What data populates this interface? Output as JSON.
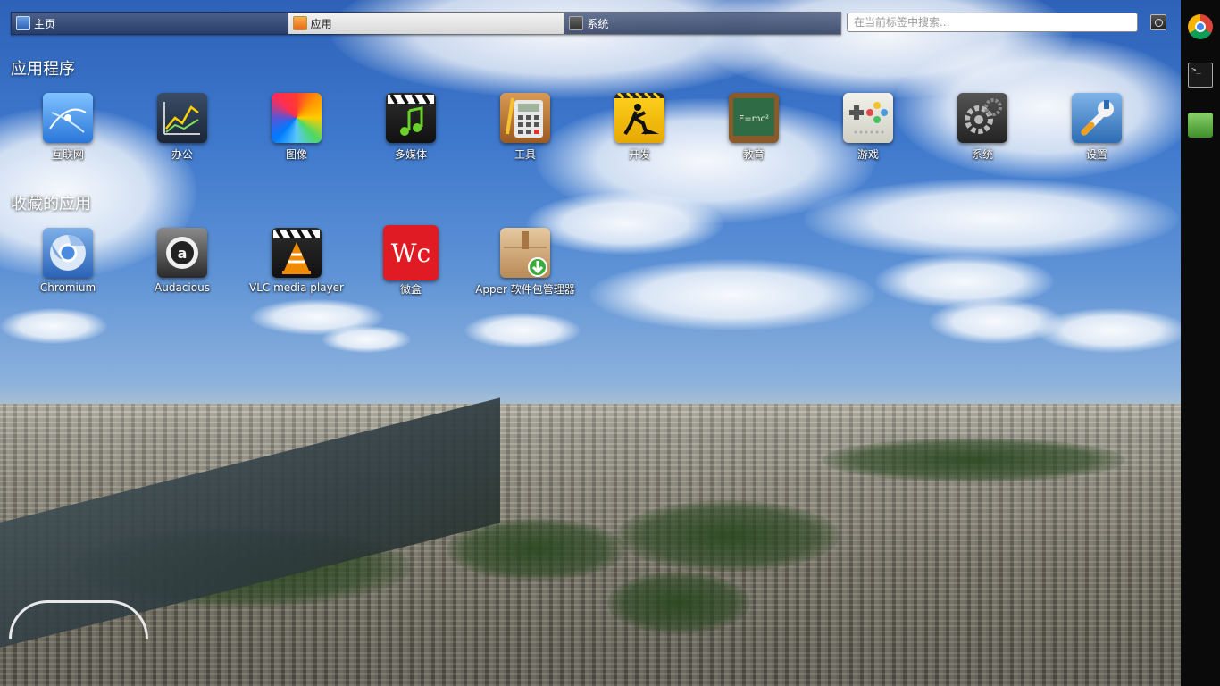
{
  "topbar": {
    "tabs": [
      {
        "label": "主页",
        "icon": "home-icon"
      },
      {
        "label": "应用",
        "icon": "apps-icon",
        "active": true
      },
      {
        "label": "系统",
        "icon": "system-icon"
      }
    ],
    "search_placeholder": "在当前标签中搜索..."
  },
  "sections": {
    "applications_title": "应用程序",
    "favorites_title": "收藏的应用"
  },
  "categories": [
    {
      "label": "互联网",
      "icon": "internet-icon"
    },
    {
      "label": "办公",
      "icon": "office-chart-icon"
    },
    {
      "label": "图像",
      "icon": "graphics-icon"
    },
    {
      "label": "多媒体",
      "icon": "multimedia-icon"
    },
    {
      "label": "工具",
      "icon": "calculator-icon"
    },
    {
      "label": "开发",
      "icon": "development-icon"
    },
    {
      "label": "教育",
      "icon": "education-chalkboard-icon"
    },
    {
      "label": "游戏",
      "icon": "gamepad-icon"
    },
    {
      "label": "系统",
      "icon": "system-gear-icon"
    },
    {
      "label": "设置",
      "icon": "settings-wrench-icon"
    }
  ],
  "favorites": [
    {
      "label": "Chromium",
      "icon": "chromium-icon"
    },
    {
      "label": "Audacious",
      "icon": "audacious-icon"
    },
    {
      "label": "VLC media player",
      "icon": "vlc-icon"
    },
    {
      "label": "微盒",
      "icon": "wc-icon",
      "icon_text": "Wc"
    },
    {
      "label": "Apper 软件包管理器",
      "icon": "apper-package-icon"
    }
  ],
  "dock": [
    {
      "icon": "chrome-icon"
    },
    {
      "icon": "terminal-icon"
    },
    {
      "icon": "leaf-app-icon"
    }
  ],
  "colors": {
    "dock_background": "#0a0a0a",
    "active_tab": "#e8e8e8"
  }
}
